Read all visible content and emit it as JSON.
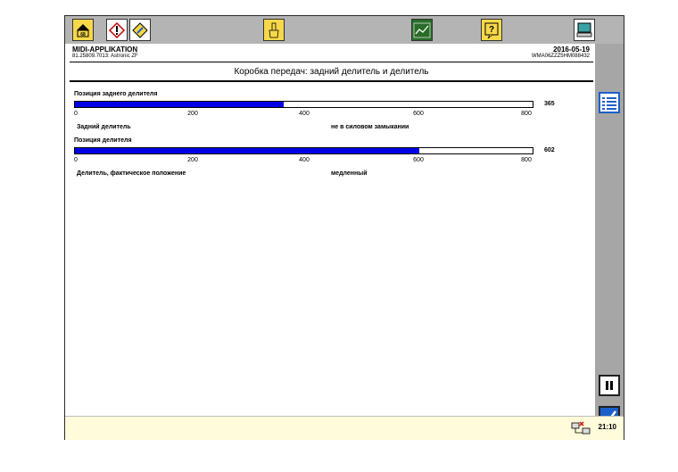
{
  "toolbar": {
    "buttons": [
      {
        "name": "home-button",
        "icon": "home-icon",
        "badge": "68"
      },
      {
        "name": "diagnostic-button",
        "icon": "warning-diamond-icon"
      },
      {
        "name": "diagnostic-pen-button",
        "icon": "diagnostic-pen-icon"
      },
      {
        "name": "hand-button",
        "icon": "hand-icon"
      },
      {
        "name": "chart-button",
        "icon": "chart-icon"
      },
      {
        "name": "help-button",
        "icon": "help-icon",
        "glyph": "?"
      },
      {
        "name": "computer-button",
        "icon": "computer-icon"
      }
    ]
  },
  "header": {
    "app_name": "MIDI-APPLIKATION",
    "app_sub": "81.25809.7013: Astronic ZF",
    "date": "2016-05-19",
    "vin": "WMA06ZZZ5HM088432"
  },
  "title": "Коробка передач: задний делитель и делитель",
  "gauges": [
    {
      "label": "Позиция заднего делителя",
      "value": 365,
      "value_text": "365",
      "max": 800,
      "ticks": [
        "0",
        "200",
        "400",
        "600",
        "800"
      ],
      "status_label": "Задний делитель",
      "status_value": "не в силовом замыкании"
    },
    {
      "label": "Позиция делителя",
      "value": 602,
      "value_text": "602",
      "max": 800,
      "ticks": [
        "0",
        "200",
        "400",
        "600",
        "800"
      ],
      "status_label": "Делитель, фактическое положение",
      "status_value": "медленный"
    }
  ],
  "right_panel": {
    "buttons": [
      "list-icon",
      "pause-icon",
      "check-icon"
    ]
  },
  "status": {
    "time": "21:10",
    "net_icon": "network-status-icon"
  },
  "colors": {
    "toolbar_bg": "#b4b4b4",
    "bar_fill": "#0000e8",
    "status_bg": "#fffbdb",
    "accent_yellow": "#f7d84a",
    "check_blue": "#1c5fc8"
  }
}
